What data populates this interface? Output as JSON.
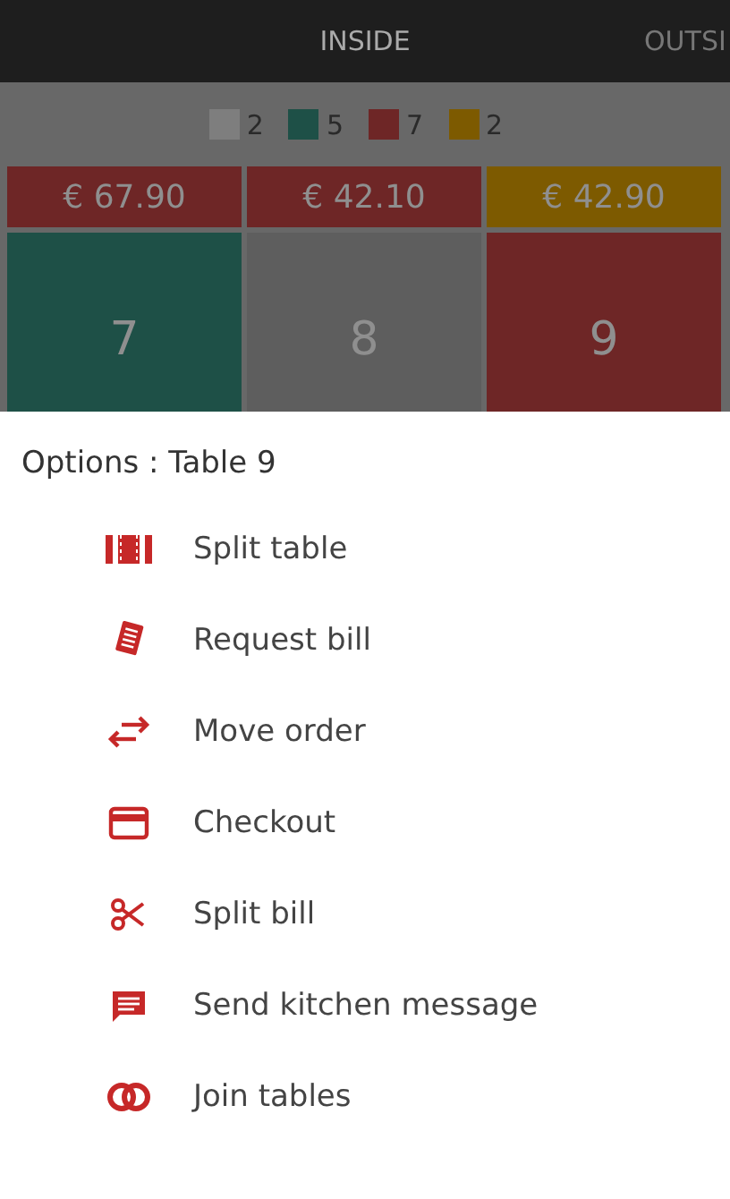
{
  "tabs": [
    {
      "label": "INSIDE",
      "selected": true
    },
    {
      "label": "OUTSI",
      "selected": false
    }
  ],
  "legend": [
    {
      "count": "2",
      "color": "#7e7e7e"
    },
    {
      "count": "5",
      "color": "#1e5047"
    },
    {
      "count": "7",
      "color": "#6e2626"
    },
    {
      "count": "2",
      "color": "#7d5a00"
    }
  ],
  "totals": [
    {
      "amount": "€ 67.90",
      "color": "#6e2626"
    },
    {
      "amount": "€ 42.10",
      "color": "#6e2626"
    },
    {
      "amount": "€ 42.90",
      "color": "#7d5a00"
    }
  ],
  "tables": [
    {
      "number": "7",
      "color": "#1e5047"
    },
    {
      "number": "8",
      "color": "#5e5e5e"
    },
    {
      "number": "9",
      "color": "#6e2626"
    }
  ],
  "sheet": {
    "title": "Options : Table 9",
    "options": [
      {
        "label": "Split table"
      },
      {
        "label": "Request bill"
      },
      {
        "label": "Move order"
      },
      {
        "label": "Checkout"
      },
      {
        "label": "Split bill"
      },
      {
        "label": "Send kitchen message"
      },
      {
        "label": "Join tables"
      }
    ]
  }
}
